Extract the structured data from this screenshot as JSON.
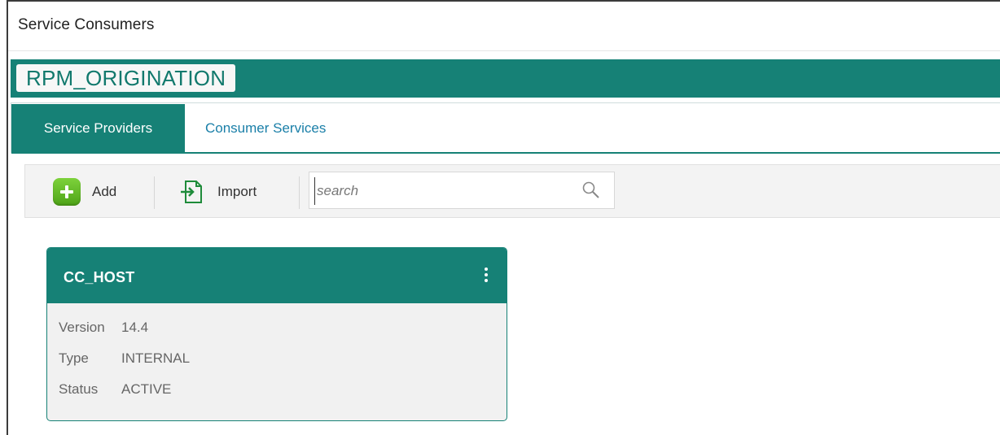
{
  "page": {
    "title": "Service Consumers"
  },
  "banner": {
    "app_name": "RPM_ORIGINATION"
  },
  "tabs": [
    {
      "label": "Service Providers",
      "active": true
    },
    {
      "label": "Consumer Services",
      "active": false
    }
  ],
  "toolbar": {
    "add_label": "Add",
    "import_label": "Import",
    "search_placeholder": "search",
    "search_value": ""
  },
  "provider_card": {
    "name": "CC_HOST",
    "properties": [
      {
        "key": "Version",
        "value": "14.4"
      },
      {
        "key": "Type",
        "value": "INTERNAL"
      },
      {
        "key": "Status",
        "value": "ACTIVE"
      }
    ]
  },
  "colors": {
    "accent": "#168176",
    "tab_link": "#1a7fa8",
    "add_green": "#5db524"
  },
  "icons": [
    "add-icon",
    "import-icon",
    "search-icon",
    "more-options-icon"
  ]
}
